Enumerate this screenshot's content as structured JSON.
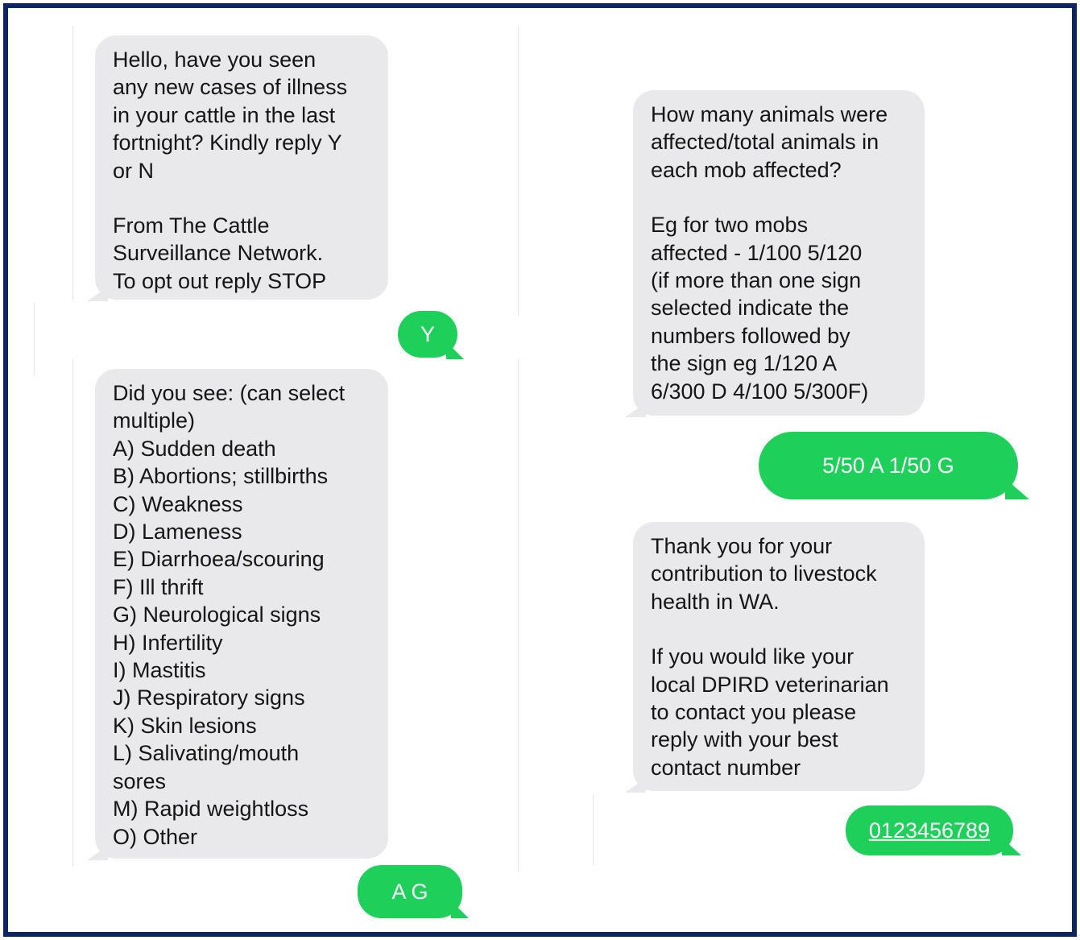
{
  "colors": {
    "incoming_bubble": "#e9e9eb",
    "outgoing_bubble": "#1ed05a",
    "frame_border": "#0c2461"
  },
  "left_column": {
    "msg_intro": {
      "para1": "Hello, have you seen\nany new cases of illness\nin your cattle in the last\nfortnight? Kindly reply Y\nor N",
      "para2": "From The Cattle\nSurveillance Network.\nTo opt out reply STOP"
    },
    "reply_y": "Y",
    "msg_signs": {
      "heading": "Did you see: (can select\nmultiple)",
      "options": [
        "A) Sudden death",
        "B) Abortions; stillbirths",
        "C) Weakness",
        "D) Lameness",
        "E) Diarrhoea/scouring",
        "F) Ill thrift",
        "G) Neurological signs",
        "H) Infertility",
        "I) Mastitis",
        "J) Respiratory signs",
        "K) Skin lesions",
        "L) Salivating/mouth\nsores",
        "M) Rapid weightloss",
        "O) Other"
      ]
    },
    "reply_ag": "A G"
  },
  "right_column": {
    "msg_count": {
      "para1": "How many animals were\naffected/total animals in\neach mob affected?",
      "para2": "Eg for two mobs\naffected - 1/100  5/120\n(if more than one sign\nselected indicate the\nnumbers followed by\nthe sign eg 1/120 A\n6/300 D 4/100 5/300F)"
    },
    "reply_counts": "5/50 A 1/50 G",
    "msg_thanks": {
      "para1": "Thank you for your\ncontribution to livestock\nhealth in WA.",
      "para2": "If you would like your\nlocal DPIRD veterinarian\nto contact you please\nreply with your best\ncontact number"
    },
    "reply_phone": "0123456789"
  }
}
